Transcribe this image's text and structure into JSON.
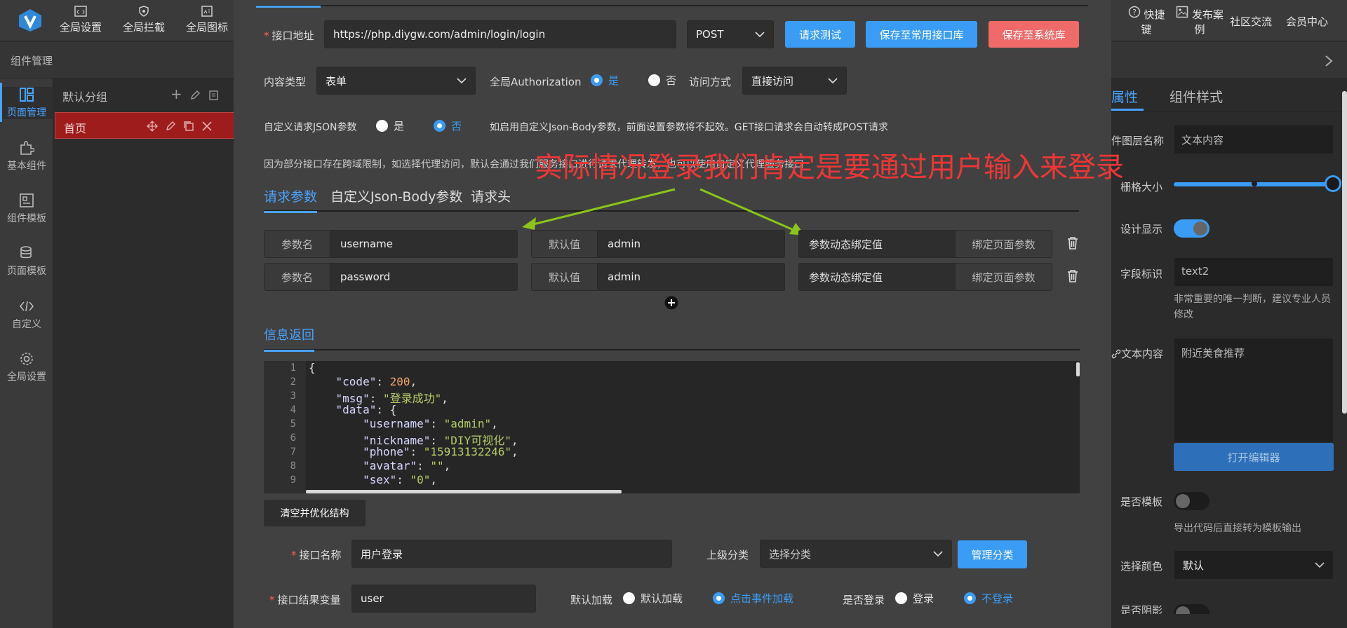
{
  "topbar": {
    "left_items": [
      {
        "label": "全局设置",
        "icon": "code-window-icon"
      },
      {
        "label": "全局拦截",
        "icon": "shield-icon"
      },
      {
        "label": "全局图标",
        "icon": "image-icon"
      }
    ],
    "right_items": [
      {
        "label": "快捷键",
        "icon": "help-circle-icon"
      },
      {
        "label": "发布案例",
        "icon": "picture-icon"
      },
      {
        "label": "社区交流"
      },
      {
        "label": "会员中心"
      }
    ]
  },
  "subbar": {
    "title": "组件管理"
  },
  "rail": [
    {
      "label": "页面管理",
      "active": true
    },
    {
      "label": "基本组件"
    },
    {
      "label": "组件模板"
    },
    {
      "label": "页面模板"
    },
    {
      "label": "自定义"
    },
    {
      "label": "全局设置"
    }
  ],
  "pages": {
    "group": "默认分组",
    "item": "首页"
  },
  "right_panel": {
    "tabs": [
      "属性",
      "组件样式"
    ],
    "layer_name_label": "件图层名称",
    "layer_name_value": "文本内容",
    "grid_label": "栅格大小",
    "design_label": "设计显示",
    "field_label": "字段标识",
    "field_value": "text2",
    "field_hint": "非常重要的唯一判断，建议专业人员修改",
    "text_label": "文本内容",
    "text_value": "附近美食推荐",
    "open_editor": "打开编辑器",
    "template_label": "是否模板",
    "template_hint": "导出代码后直接转为模板输出",
    "color_label": "选择颜色",
    "color_value": "默认",
    "shadow_label": "是否阴影"
  },
  "modal": {
    "url_label": "接口地址",
    "url_value": "https://php.diygw.com/admin/login/login",
    "method": "POST",
    "btn_test": "请求测试",
    "btn_save_common": "保存至常用接口库",
    "btn_save_system": "保存至系统库",
    "content_type_label": "内容类型",
    "content_type_value": "表单",
    "auth_label": "全局Authorization",
    "auth_yes": "是",
    "auth_no": "否",
    "access_label": "访问方式",
    "access_value": "直接访问",
    "json_label": "自定义请求JSON参数",
    "json_yes": "是",
    "json_no": "否",
    "json_note": "如启用自定义Json-Body参数，前面设置参数将不起效。GET接口请求会自动转成POST请求",
    "proxy_note": "因为部分接口存在跨域限制，如选择代理访问，默认会通过我们服务接口进行请求代理转发，也可以使用自定义代理服务接口",
    "annotation": "实际情况登录我们肯定是要通过用户输入来登录",
    "tabs": [
      "请求参数",
      "自定义Json-Body参数",
      "请求头"
    ],
    "params": [
      {
        "key_label": "参数名",
        "key": "username",
        "default_label": "默认值",
        "default": "admin",
        "dyn": "参数动态绑定值",
        "bind": "绑定页面参数"
      },
      {
        "key_label": "参数名",
        "key": "password",
        "default_label": "默认值",
        "default": "admin",
        "dyn": "参数动态绑定值",
        "bind": "绑定页面参数"
      }
    ],
    "response_tab": "信息返回",
    "code_lines": [
      "1",
      "2",
      "3",
      "4",
      "5",
      "6",
      "7",
      "8",
      "9"
    ],
    "response": {
      "code_key": "\"code\"",
      "code_val": "200",
      "msg_key": "\"msg\"",
      "msg_val": "\"登录成功\"",
      "data_key": "\"data\"",
      "username_key": "\"username\"",
      "username_val": "\"admin\"",
      "nickname_key": "\"nickname\"",
      "nickname_val": "\"DIY可视化\"",
      "phone_key": "\"phone\"",
      "phone_val": "\"15913132246\"",
      "avatar_key": "\"avatar\"",
      "avatar_val": "\"\"",
      "sex_key": "\"sex\"",
      "sex_val": "\"0\""
    },
    "btn_clear": "清空并优化结构",
    "api_name_label": "接口名称",
    "api_name_value": "用户登录",
    "parent_label": "上级分类",
    "parent_value": "选择分类",
    "btn_manage": "管理分类",
    "result_var_label": "接口结果变量",
    "result_var_value": "user",
    "load_label": "默认加载",
    "load_opt1": "默认加载",
    "load_opt2": "点击事件加载",
    "login_label": "是否登录",
    "login_opt1": "登录",
    "login_opt2": "不登录"
  }
}
